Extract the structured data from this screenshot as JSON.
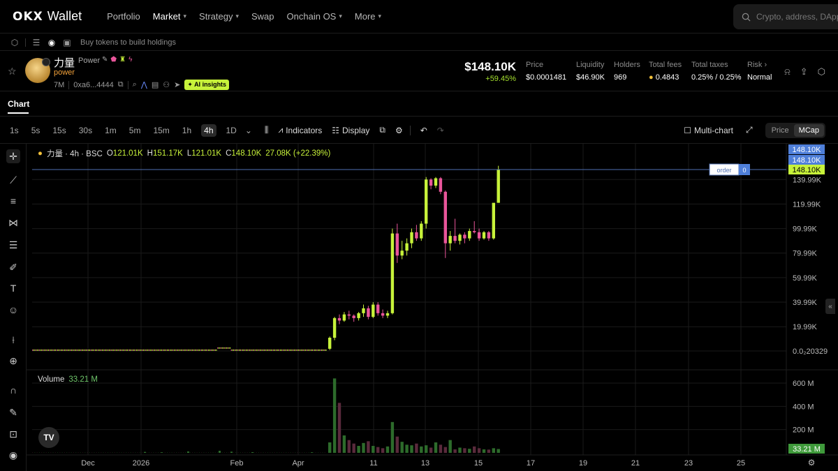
{
  "nav": {
    "logo": "OKX",
    "logo_suffix": "Wallet",
    "items": [
      {
        "label": "Portfolio",
        "has_menu": false
      },
      {
        "label": "Market",
        "has_menu": true
      },
      {
        "label": "Strategy",
        "has_menu": true
      },
      {
        "label": "Swap",
        "has_menu": false
      },
      {
        "label": "Onchain OS",
        "has_menu": true
      },
      {
        "label": "More",
        "has_menu": true
      }
    ],
    "search_placeholder": "Crypto, address, DApp"
  },
  "holdings": {
    "text": "Buy tokens to build holdings"
  },
  "token": {
    "name": "力量",
    "symbol": "Power",
    "label": "power",
    "age": "7M",
    "address": "0xa6...4444",
    "ai_badge": "AI insights",
    "market_cap": "$148.10K",
    "change": "+59.45%",
    "stats": [
      {
        "label": "Price",
        "value": "$0.0001481"
      },
      {
        "label": "Liquidity",
        "value": "$46.90K"
      },
      {
        "label": "Holders",
        "value": "969"
      },
      {
        "label": "Total fees",
        "value": "0.4843"
      },
      {
        "label": "Total taxes",
        "value": "0.25% / 0.25%"
      },
      {
        "label": "Risk",
        "value": "Normal"
      }
    ]
  },
  "tab": {
    "label": "Chart"
  },
  "toolbar": {
    "timeframes": [
      "1s",
      "5s",
      "15s",
      "30s",
      "1m",
      "5m",
      "15m",
      "1h",
      "4h",
      "1D"
    ],
    "active_timeframe": "4h",
    "indicators_label": "Indicators",
    "display_label": "Display",
    "multichart_label": "Multi-chart",
    "toggle": [
      "Price",
      "MCap"
    ],
    "toggle_active": "MCap"
  },
  "legend": {
    "symbol": "力量 · 4h · BSC",
    "o_label": "O",
    "o": "121.01K",
    "h_label": "H",
    "h": "151.17K",
    "l_label": "L",
    "l": "121.01K",
    "c_label": "C",
    "c": "148.10K",
    "change": "27.08K (+22.39%)",
    "volume_label": "Volume",
    "volume_value": "33.21 M"
  },
  "chart_data": {
    "type": "candlestick",
    "price_axis_labels": [
      "139.99K",
      "119.99K",
      "99.99K",
      "79.99K",
      "59.99K",
      "39.99K",
      "19.99K",
      "0.0₂20329"
    ],
    "price_axis_values": [
      139.99,
      119.99,
      99.99,
      79.99,
      59.99,
      39.99,
      19.99,
      0.2
    ],
    "price_tags": [
      "148.10K",
      "148.10K",
      "148.10K"
    ],
    "volume_axis_labels": [
      "600 M",
      "400 M",
      "200 M"
    ],
    "volume_axis_values": [
      600,
      400,
      200
    ],
    "volume_tag": "33.21 M",
    "x_axis_labels": [
      "Dec",
      "2026",
      "Feb",
      "Apr",
      "11",
      "13",
      "15",
      "17",
      "19",
      "21",
      "23",
      "25"
    ],
    "order_line": {
      "label": "order",
      "count": "0",
      "value": 148.1
    },
    "candles_flat": [
      0.2,
      0.2,
      0.2,
      0.2,
      0.2,
      0.2,
      0.2,
      0.2,
      0.2,
      0.2,
      0.2,
      0.2,
      0.2,
      0.2,
      0.2,
      0.2,
      0.2,
      0.2,
      0.2,
      0.2,
      0.2,
      0.2,
      0.2,
      0.2,
      0.2,
      0.2,
      0.2,
      0.2,
      0.2,
      0.2,
      0.2,
      0.2,
      0.2,
      0.2,
      0.2,
      0.2,
      0.2,
      0.2,
      0.2,
      0.2,
      0.2,
      0.2,
      0.2,
      0.2,
      0.2,
      0.2,
      0.2,
      0.2,
      0.2,
      0.2,
      0.2,
      0.2,
      0.2,
      0.2,
      0.2,
      0.2,
      0.2,
      0.2,
      0.2,
      0.2,
      0.2,
      0.2,
      0.2,
      0.2,
      0.2,
      0.2,
      0.2,
      0.2,
      0.2,
      0.2,
      0.2,
      0.2,
      0.2,
      0.2,
      0.2,
      0.2,
      0.2,
      0.2,
      0.2,
      0.2,
      0.2,
      0.2,
      0.2,
      0.2,
      0.2,
      0.2,
      0.2,
      0.2,
      0.2,
      0.2,
      0.2,
      0.2,
      0.2,
      0.2,
      0.2,
      0.2,
      0.2,
      0.2,
      0.2,
      0.2,
      0.2,
      0.2,
      0.2,
      0.2,
      0.2,
      0.2,
      0.2,
      0.2,
      0.2,
      0.2,
      0.2,
      0.2,
      0.2,
      0.2,
      0.2,
      0.2,
      0.2,
      0.2,
      0.2,
      0.2,
      0.2,
      0.2,
      0.2,
      0.2,
      0.2,
      0.2,
      0.2,
      0.2,
      0.2,
      0.2,
      0.2,
      0.2,
      0.2,
      0.2,
      0.2,
      0.2,
      0.2,
      0.2,
      0.2,
      0.2,
      0.2,
      0.2,
      0.2,
      0.2,
      0.2,
      0.2,
      0.2,
      0.2,
      0.2,
      0.2,
      0.2,
      0.2,
      0.2,
      0.2,
      0.2,
      0.2,
      0.2,
      0.2,
      0.2,
      0.2,
      0.2,
      0.2,
      0.2,
      0.2,
      0.2,
      0.2,
      0.2,
      0.2,
      0.2,
      0.2,
      0.2,
      0.2,
      0.2,
      0.2,
      0.2,
      0.2,
      0.2,
      0.2,
      0.2,
      0.2,
      0.2,
      0.2,
      0.2,
      0.2,
      0.2,
      0.2,
      0.2,
      0.2,
      0.2,
      0.2,
      0.2,
      0.2,
      0.2,
      0.2,
      0.2,
      0.2,
      0.2,
      0.2,
      0.2,
      0.2,
      0.2,
      0.2,
      0.2,
      0.2,
      0.2,
      0.2,
      0.2,
      0.2,
      0.2,
      0.2,
      0.2,
      0.2,
      0.2,
      0.2,
      0.2,
      0.2,
      0.2,
      0.2,
      0.2,
      0.2,
      0.2,
      0.2,
      0.2,
      0.2,
      0.2,
      0.2,
      0.2,
      0.2,
      0.2,
      0.2,
      0.2,
      0.2,
      0.2,
      0.2,
      0.2,
      0.2,
      0.2,
      0.2,
      0.2,
      0.2,
      0.2,
      0.2,
      0.2,
      0.2,
      0.2,
      0.2,
      0.2,
      0.2,
      0.2,
      0.2,
      0.2,
      0.2,
      0.2,
      0.2,
      0.2,
      0.2,
      0.2,
      0.2
    ],
    "candles": [
      {
        "o": 2,
        "h": 12,
        "l": 1,
        "c": 11
      },
      {
        "o": 11,
        "h": 28,
        "l": 9,
        "c": 27
      },
      {
        "o": 27,
        "h": 30,
        "l": 22,
        "c": 25
      },
      {
        "o": 25,
        "h": 32,
        "l": 24,
        "c": 30
      },
      {
        "o": 30,
        "h": 33,
        "l": 26,
        "c": 29
      },
      {
        "o": 29,
        "h": 30,
        "l": 24,
        "c": 27
      },
      {
        "o": 27,
        "h": 32,
        "l": 25,
        "c": 31
      },
      {
        "o": 31,
        "h": 38,
        "l": 28,
        "c": 35
      },
      {
        "o": 35,
        "h": 37,
        "l": 26,
        "c": 28
      },
      {
        "o": 28,
        "h": 40,
        "l": 27,
        "c": 38
      },
      {
        "o": 38,
        "h": 40,
        "l": 29,
        "c": 31
      },
      {
        "o": 31,
        "h": 34,
        "l": 27,
        "c": 29
      },
      {
        "o": 29,
        "h": 33,
        "l": 27,
        "c": 31
      },
      {
        "o": 31,
        "h": 100,
        "l": 30,
        "c": 96
      },
      {
        "o": 96,
        "h": 104,
        "l": 72,
        "c": 78
      },
      {
        "o": 78,
        "h": 90,
        "l": 75,
        "c": 82
      },
      {
        "o": 82,
        "h": 92,
        "l": 78,
        "c": 88
      },
      {
        "o": 88,
        "h": 100,
        "l": 84,
        "c": 97
      },
      {
        "o": 97,
        "h": 103,
        "l": 90,
        "c": 92
      },
      {
        "o": 92,
        "h": 106,
        "l": 90,
        "c": 104
      },
      {
        "o": 104,
        "h": 142,
        "l": 100,
        "c": 140
      },
      {
        "o": 140,
        "h": 141,
        "l": 132,
        "c": 135
      },
      {
        "o": 135,
        "h": 142,
        "l": 133,
        "c": 141
      },
      {
        "o": 141,
        "h": 142,
        "l": 128,
        "c": 130
      },
      {
        "o": 130,
        "h": 131,
        "l": 76,
        "c": 88
      },
      {
        "o": 88,
        "h": 98,
        "l": 82,
        "c": 94
      },
      {
        "o": 94,
        "h": 108,
        "l": 88,
        "c": 90
      },
      {
        "o": 90,
        "h": 96,
        "l": 87,
        "c": 95
      },
      {
        "o": 95,
        "h": 97,
        "l": 88,
        "c": 92
      },
      {
        "o": 92,
        "h": 100,
        "l": 90,
        "c": 98
      },
      {
        "o": 98,
        "h": 106,
        "l": 96,
        "c": 97
      },
      {
        "o": 97,
        "h": 100,
        "l": 90,
        "c": 92
      },
      {
        "o": 92,
        "h": 98,
        "l": 91,
        "c": 97
      },
      {
        "o": 97,
        "h": 98,
        "l": 90,
        "c": 92
      },
      {
        "o": 92,
        "h": 106,
        "l": 91,
        "c": 121
      },
      {
        "o": 121.01,
        "h": 151.17,
        "l": 121.01,
        "c": 148.1
      }
    ],
    "volume_flat_m": 2,
    "volumes_m": [
      90,
      640,
      430,
      150,
      110,
      80,
      60,
      85,
      100,
      60,
      50,
      40,
      55,
      265,
      140,
      95,
      70,
      65,
      80,
      55,
      65,
      45,
      90,
      70,
      50,
      110,
      30,
      45,
      40,
      35,
      55,
      40,
      30,
      28,
      40,
      33.21
    ],
    "colors": {
      "up": "#c7f23a",
      "down": "#e9559a",
      "vol_up": "#2d6b2b",
      "vol_down": "#5a2a3c",
      "grid": "#1a1a1a",
      "order_line": "#4f6fb2",
      "tag": "#4f7fd9",
      "tag_current": "#c7f23a"
    }
  }
}
